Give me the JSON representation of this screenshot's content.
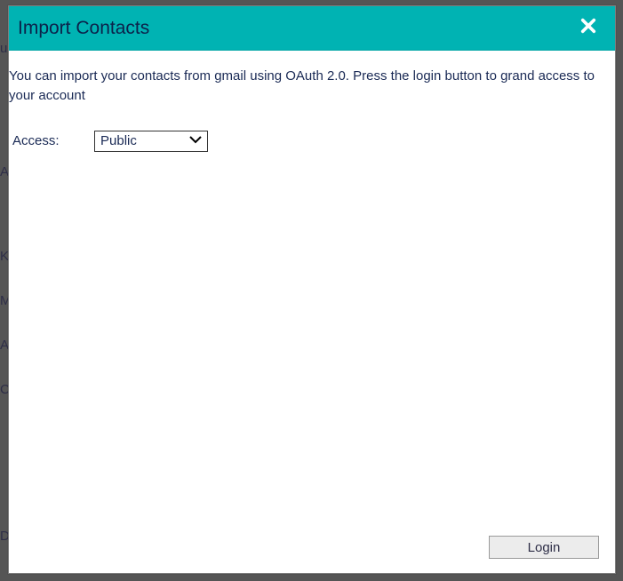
{
  "dialog": {
    "title": "Import Contacts",
    "intro": "You can import your contacts from gmail using OAuth 2.0. Press the login button to grand access to your account",
    "access_label": "Access:",
    "access_value": "Public",
    "login_label": "Login"
  },
  "bg_glyphs": [
    "u",
    "A",
    "K",
    "M",
    "A",
    "C",
    "D"
  ]
}
